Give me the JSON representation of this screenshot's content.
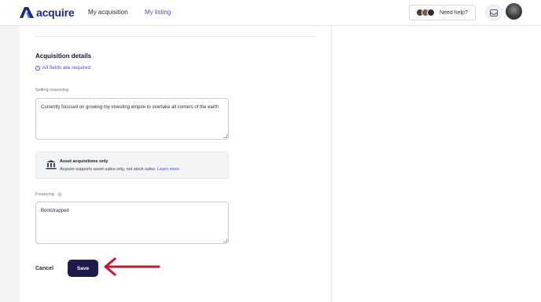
{
  "header": {
    "brand": "acquire",
    "nav": [
      {
        "label": "My acquisition"
      },
      {
        "label": "My listing"
      }
    ],
    "help_label": "Need help?"
  },
  "form": {
    "section_title": "Acquisition details",
    "required_note": "All fields are required",
    "selling_reasoning": {
      "label": "Selling reasoning",
      "value": "Currently focused on growing my investing empire to overtake all corners of the earth"
    },
    "notice": {
      "title": "Asset acquisitions only",
      "text": "Acquire supports asset sales only, not stock sales.",
      "link": "Learn more"
    },
    "financing": {
      "label": "Financing",
      "value": "Bootstrapped"
    },
    "cancel_label": "Cancel",
    "save_label": "Save"
  },
  "colors": {
    "brand": "#1e2a78",
    "accent": "#4f46e5",
    "save_button": "#1e1b4b",
    "annotation_arrow": "#d0142c"
  }
}
